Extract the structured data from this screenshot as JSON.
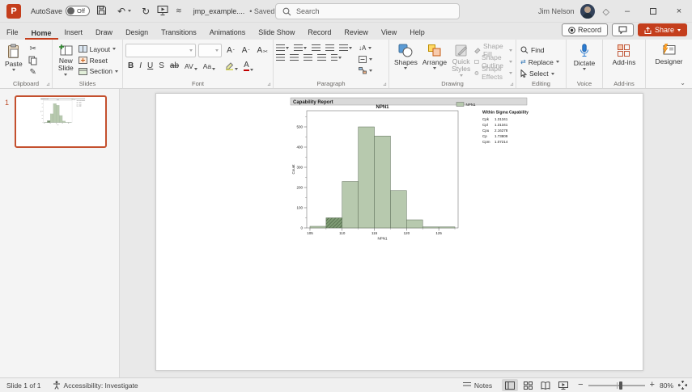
{
  "titlebar": {
    "app_letter": "P",
    "autosave_label": "AutoSave",
    "autosave_state": "Off",
    "filename": "jmp_example....",
    "saved_status": "• Saved to this PC",
    "search_placeholder": "Search",
    "user_name": "Jim Nelson"
  },
  "tabs": {
    "items": [
      "File",
      "Home",
      "Insert",
      "Draw",
      "Design",
      "Transitions",
      "Animations",
      "Slide Show",
      "Record",
      "Review",
      "View",
      "Help"
    ],
    "active": "Home",
    "record_button": "Record",
    "share_button": "Share"
  },
  "ribbon": {
    "clipboard": {
      "group_label": "Clipboard",
      "paste_label": "Paste"
    },
    "slides": {
      "group_label": "Slides",
      "new_slide_label": "New Slide",
      "layout_label": "Layout",
      "reset_label": "Reset",
      "section_label": "Section"
    },
    "font": {
      "group_label": "Font",
      "bold": "B",
      "italic": "I",
      "underline": "U",
      "shadow": "S",
      "strikethrough": "ab",
      "char_spacing": "AV",
      "change_case": "Aa",
      "grow_font": "A",
      "shrink_font": "A",
      "clear_format": "A",
      "font_color": "A"
    },
    "paragraph": {
      "group_label": "Paragraph"
    },
    "drawing": {
      "group_label": "Drawing",
      "shapes_label": "Shapes",
      "arrange_label": "Arrange",
      "quick_styles_label": "Quick Styles",
      "shape_fill_label": "Shape Fill",
      "shape_outline_label": "Shape Outline",
      "shape_effects_label": "Shape Effects"
    },
    "editing": {
      "group_label": "Editing",
      "find_label": "Find",
      "replace_label": "Replace",
      "select_label": "Select"
    },
    "voice": {
      "group_label": "Voice",
      "dictate_label": "Dictate"
    },
    "addins": {
      "group_label": "Add-ins",
      "button_label": "Add-ins"
    },
    "designer": {
      "button_label": "Designer"
    }
  },
  "slides_panel": {
    "slide_number": "1"
  },
  "chart_data": {
    "type": "bar",
    "report_title": "Capability Report",
    "title": "NPN1",
    "xlabel": "NPN1",
    "ylabel": "Count",
    "legend": [
      {
        "label": "NPN1",
        "color": "#b7c9ae"
      }
    ],
    "bin_edges": [
      105,
      107.5,
      110,
      112.5,
      115,
      117.5,
      120,
      122.5,
      125,
      127.5
    ],
    "counts": [
      8,
      50,
      230,
      500,
      455,
      185,
      40,
      5,
      5
    ],
    "highlighted_bin_index": 1,
    "xticks": [
      105,
      110,
      115,
      120,
      125
    ],
    "yticks": [
      0,
      100,
      200,
      300,
      400,
      500
    ],
    "xlim": [
      104.5,
      128
    ],
    "ylim": [
      0,
      580
    ],
    "colors": {
      "bar_fill": "#b7c9ae",
      "bar_stroke": "#5e6e59",
      "highlight_fill": "#7e9b74",
      "hatch_stroke": "#41573b",
      "header_bg": "#d9d9d9"
    },
    "stats": {
      "title": "Within Sigma Capability",
      "rows": [
        {
          "label": "Cpk",
          "value": "1.31341"
        },
        {
          "label": "Cpl",
          "value": "1.31341"
        },
        {
          "label": "Cpu",
          "value": "2.16278"
        },
        {
          "label": "Cp",
          "value": "1.73809"
        },
        {
          "label": "Cpm",
          "value": "1.07214"
        }
      ]
    }
  },
  "statusbar": {
    "slide_info": "Slide 1 of 1",
    "accessibility": "Accessibility: Investigate",
    "notes_label": "Notes",
    "zoom_level": "80%"
  }
}
